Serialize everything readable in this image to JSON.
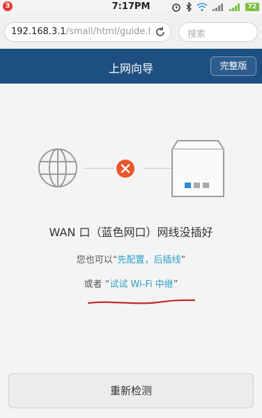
{
  "statusbar": {
    "time": "7:17PM",
    "notification_count": "3",
    "battery": "72"
  },
  "addressbar": {
    "url_host": "192.168.3.1",
    "url_path": "/small/html/guide.htm",
    "search_placeholder": "搜索"
  },
  "header": {
    "title": "上网向导",
    "full_version_label": "完整版"
  },
  "diagram": {
    "left_icon": "globe-icon",
    "middle_icon": "error-x-icon",
    "right_icon": "router-icon",
    "error_color": "#e8572b"
  },
  "message": {
    "status": "WAN 口（蓝色网口）网线没插好",
    "line2_prefix": "您也可以“",
    "line2_link": "先配置，后插线",
    "line2_suffix": "”",
    "line3_prefix": "或者 “",
    "line3_link": "试试 Wi-Fi 中继",
    "line3_suffix": "”"
  },
  "actions": {
    "redetect_label": "重新检测"
  },
  "colors": {
    "header_bg": "#1d4f80",
    "link": "#2aa0c9",
    "annotation": "#c62828"
  }
}
